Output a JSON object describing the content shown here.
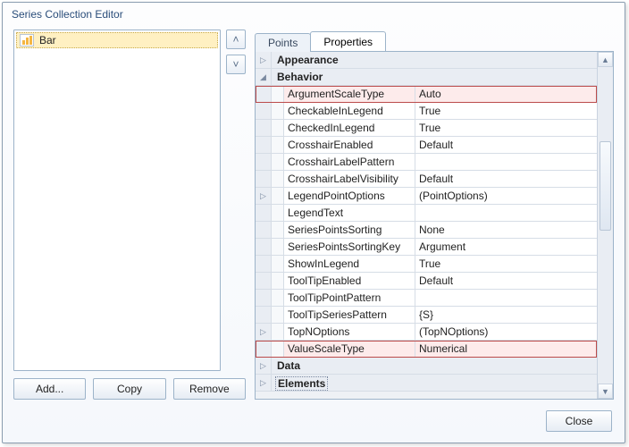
{
  "title": "Series Collection Editor",
  "list": {
    "items": [
      "Bar"
    ]
  },
  "buttons": {
    "add": "Add...",
    "copy": "Copy",
    "remove": "Remove",
    "close": "Close"
  },
  "tabs": {
    "points": "Points",
    "properties": "Properties",
    "active": "Properties"
  },
  "categories": {
    "appearance": "Appearance",
    "behavior": "Behavior",
    "data": "Data",
    "elements": "Elements"
  },
  "props": {
    "ArgumentScaleType": "Auto",
    "CheckableInLegend": "True",
    "CheckedInLegend": "True",
    "CrosshairEnabled": "Default",
    "CrosshairLabelPattern": "",
    "CrosshairLabelVisibility": "Default",
    "LegendPointOptions": "(PointOptions)",
    "LegendText": "",
    "SeriesPointsSorting": "None",
    "SeriesPointsSortingKey": "Argument",
    "ShowInLegend": "True",
    "ToolTipEnabled": "Default",
    "ToolTipPointPattern": "",
    "ToolTipSeriesPattern": "{S}",
    "TopNOptions": "(TopNOptions)",
    "ValueScaleType": "Numerical"
  },
  "labels": {
    "ArgumentScaleType": "ArgumentScaleType",
    "CheckableInLegend": "CheckableInLegend",
    "CheckedInLegend": "CheckedInLegend",
    "CrosshairEnabled": "CrosshairEnabled",
    "CrosshairLabelPattern": "CrosshairLabelPattern",
    "CrosshairLabelVisibility": "CrosshairLabelVisibility",
    "LegendPointOptions": "LegendPointOptions",
    "LegendText": "LegendText",
    "SeriesPointsSorting": "SeriesPointsSorting",
    "SeriesPointsSortingKey": "SeriesPointsSortingKey",
    "ShowInLegend": "ShowInLegend",
    "ToolTipEnabled": "ToolTipEnabled",
    "ToolTipPointPattern": "ToolTipPointPattern",
    "ToolTipSeriesPattern": "ToolTipSeriesPattern",
    "TopNOptions": "TopNOptions",
    "ValueScaleType": "ValueScaleType"
  }
}
